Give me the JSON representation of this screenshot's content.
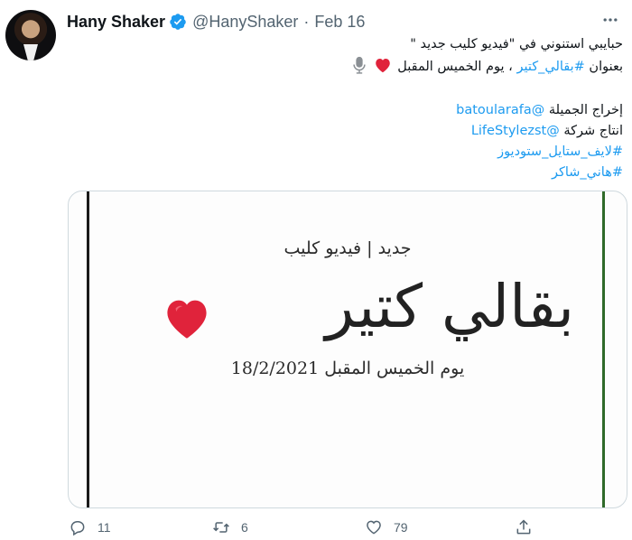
{
  "author": {
    "name": "Hany Shaker",
    "handle": "@HanyShaker",
    "separator": "·",
    "date": "Feb 16",
    "verified": true
  },
  "tweet": {
    "line1": "حبايبي استنوني في \"فيديو كليب جديد \"",
    "line2_prefix": "بعنوان ",
    "line2_hashtag": "#بقالي_كتير",
    "line2_suffix": " ، يوم الخميس المقبل",
    "line3_prefix": "إخراج الجميلة ",
    "line3_mention": "@batoularafa",
    "line4_prefix": "انتاج شركة ",
    "line4_mention": "@LifeStylezst",
    "line5_hashtag": "#لايف_ستايل_ستوديوز",
    "line6_hashtag": "#هاني_شاكر"
  },
  "media": {
    "subtitle": "جديد | فيديو كليب",
    "title": "بقالي كتير",
    "release_line": "يوم الخميس المقبل 18/2/2021"
  },
  "actions": {
    "reply_count": "11",
    "retweet_count": "6",
    "like_count": "79"
  },
  "icons": {
    "verified": "verified-badge-icon",
    "more": "more-icon",
    "heart": "red-heart-icon",
    "mic": "microphone-icon",
    "reply": "reply-icon",
    "retweet": "retweet-icon",
    "like": "like-icon",
    "share": "share-icon"
  },
  "colors": {
    "link": "#1d9bf0",
    "verified": "#1d9bf0",
    "secondary_text": "#536471",
    "heart": "#e0233b"
  }
}
